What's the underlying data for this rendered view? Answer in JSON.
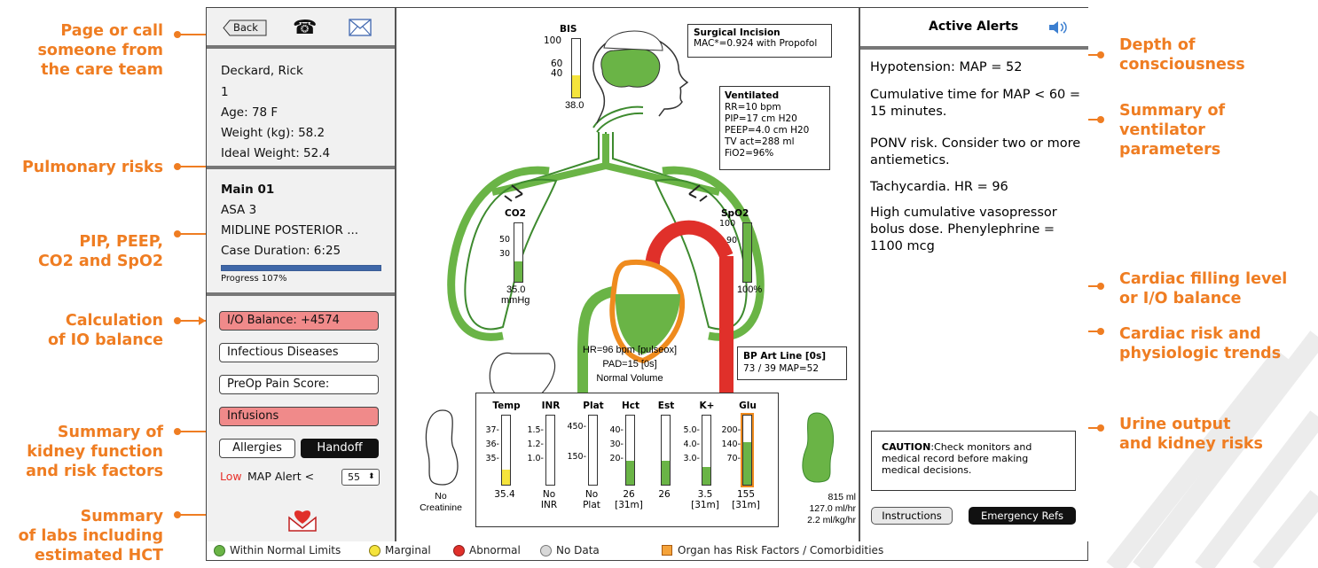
{
  "callouts_left": [
    "Page or call\nsomeone from\nthe care team",
    "Pulmonary risks",
    "PIP, PEEP,\nCO2 and SpO2",
    "Calculation\nof IO balance",
    "Summary of\nkidney function\nand risk factors",
    "Summary\nof labs including\nestimated HCT"
  ],
  "callouts_right": [
    "Depth of\nconsciousness",
    "Summary of\nventilator\nparameters",
    "Cardiac filling level\nor I/O balance",
    "Cardiac risk and\nphysiologic trends",
    "Urine output\nand kidney risks"
  ],
  "header": {
    "back_label": "Back",
    "phone_icon": "phone-icon",
    "mail_icon": "mail-icon"
  },
  "patient": {
    "name": "Deckard, Rick",
    "id": "1",
    "age": "Age: 78 F",
    "weight": "Weight (kg): 58.2",
    "ideal_weight": "Ideal Weight: 52.4"
  },
  "case": {
    "room": "Main 01",
    "asa": "ASA 3",
    "procedure": "MIDLINE POSTERIOR ...",
    "duration": "Case Duration: 6:25",
    "progress_label": "Progress 107%",
    "progress_fraction": 1.0
  },
  "buttons": {
    "io_balance": "I/O Balance: +4574",
    "infectious": "Infectious Diseases",
    "preop_pain": "PreOp Pain Score:",
    "infusions": "Infusions",
    "allergies": "Allergies",
    "handoff": "Handoff"
  },
  "map_alert": {
    "low": "Low",
    "label": "MAP Alert <",
    "value": "55"
  },
  "bis": {
    "label": "BIS",
    "ticks": [
      "100",
      "60",
      "40"
    ],
    "value": "38.0",
    "level": 0.38
  },
  "surgical": {
    "title": "Surgical Incision",
    "line": "MAC*=0.924 with Propofol"
  },
  "ventilation": {
    "title": "Ventilated",
    "lines": [
      "RR=10 bpm",
      "PIP=17 cm H20",
      "PEEP=4.0 cm H20",
      "TV act=288 ml",
      "FiO2=96%"
    ]
  },
  "co2": {
    "label": "CO2",
    "ticks": [
      "50",
      "30"
    ],
    "value": "35.0",
    "unit": "mmHg",
    "level": 0.35
  },
  "spo2": {
    "label": "SpO2",
    "ticks": [
      "100",
      "90"
    ],
    "value": "100%",
    "level": 1.0
  },
  "heart": {
    "line1": "HR=96 bpm [pulseox]",
    "line2": "PAD=15 [0s]",
    "line3": "Normal Volume"
  },
  "bp": {
    "title": "BP Art Line [0s]",
    "value": "73 / 39 MAP=52"
  },
  "labs": {
    "items": [
      {
        "name": "Temp",
        "ticks": [
          "37",
          "36",
          "35"
        ],
        "value": "35.4",
        "sub": ""
      },
      {
        "name": "INR",
        "ticks": [
          "1.5",
          "1.2",
          "1.0"
        ],
        "value": "No",
        "sub": "INR"
      },
      {
        "name": "Plat",
        "ticks": [
          "450",
          "150"
        ],
        "value": "No",
        "sub": "Plat"
      },
      {
        "name": "Hct",
        "ticks": [
          "40",
          "30",
          "20"
        ],
        "value": "26",
        "sub": "[31m]"
      },
      {
        "name": "Est",
        "ticks": [],
        "value": "26",
        "sub": ""
      },
      {
        "name": "K+",
        "ticks": [
          "5.0",
          "4.0",
          "3.0"
        ],
        "value": "3.5",
        "sub": "[31m]"
      },
      {
        "name": "Glu",
        "ticks": [
          "200",
          "140",
          "70"
        ],
        "value": "155",
        "sub": "[31m]"
      }
    ]
  },
  "kidney_left": {
    "line1": "No",
    "line2": "Creatinine"
  },
  "urine": {
    "line1": "815 ml",
    "line2": "127.0 ml/hr",
    "line3": "2.2 ml/kg/hr"
  },
  "alerts": {
    "title": "Active Alerts",
    "items": [
      {
        "text": "Hypotension: MAP = 52",
        "color": "#e8302a"
      },
      {
        "text": "Cumulative time for MAP < 60 = 15 minutes.",
        "color": "#e8302a"
      },
      {
        "text": "PONV risk. Consider two or more antiemetics.",
        "color": "#111111"
      },
      {
        "text": "Tachycardia. HR = 96",
        "color": "#111111"
      },
      {
        "text": "High cumulative vasopressor bolus dose. Phenylephrine = 1100 mcg",
        "color": "#111111"
      }
    ],
    "caution_bold": "CAUTION",
    "caution_text": ":Check monitors and medical record before making medical decisions.",
    "instructions": "Instructions",
    "emergency": "Emergency Refs"
  },
  "legend": {
    "normal": "Within Normal Limits",
    "marginal": "Marginal",
    "abnormal": "Abnormal",
    "nodata": "No Data",
    "risk": "Organ has Risk Factors / Comorbidities"
  },
  "colors": {
    "accent_orange": "#ef7d22",
    "normal_green": "#6ab446",
    "marginal_yellow": "#f5e43c",
    "abnormal_red": "#e0302a",
    "nodata_gray": "#d8d8d8"
  }
}
